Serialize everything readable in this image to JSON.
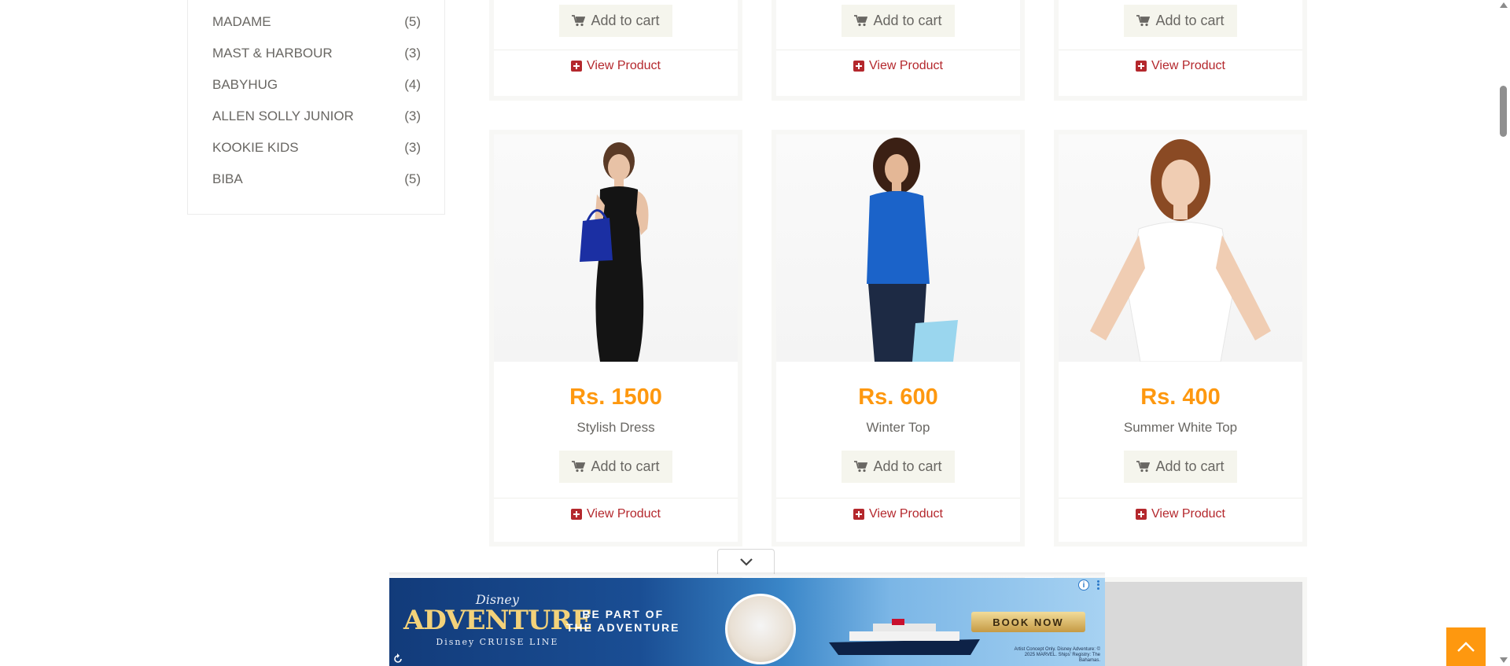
{
  "sidebar": {
    "brands": [
      {
        "name": "MADAME",
        "count": "(5)"
      },
      {
        "name": "MAST & HARBOUR",
        "count": "(3)"
      },
      {
        "name": "BABYHUG",
        "count": "(4)"
      },
      {
        "name": "ALLEN SOLLY JUNIOR",
        "count": "(3)"
      },
      {
        "name": "KOOKIE KIDS",
        "count": "(3)"
      },
      {
        "name": "BIBA",
        "count": "(5)"
      }
    ]
  },
  "top_row": [
    {
      "add_to_cart": "Add to cart",
      "view_product": "View Product"
    },
    {
      "add_to_cart": "Add to cart",
      "view_product": "View Product"
    },
    {
      "add_to_cart": "Add to cart",
      "view_product": "View Product"
    }
  ],
  "products": [
    {
      "price": "Rs. 1500",
      "name": "Stylish Dress",
      "add_to_cart": "Add to cart",
      "view_product": "View Product"
    },
    {
      "price": "Rs. 600",
      "name": "Winter Top",
      "add_to_cart": "Add to cart",
      "view_product": "View Product"
    },
    {
      "price": "Rs. 400",
      "name": "Summer White Top",
      "add_to_cart": "Add to cart",
      "view_product": "View Product"
    }
  ],
  "ad": {
    "brand_top": "Disney",
    "brand_main": "ADVENTURE",
    "brand_sub": "Disney CRUISE LINE",
    "tagline_1": "BE PART OF",
    "tagline_2": "THE ADVENTURE",
    "cta": "BOOK NOW",
    "fine_print": "Artist Concept Only. Disney Adventure: © 2025 MARVEL. Ships' Registry: The Bahamas.",
    "info_icon": "info-icon",
    "menu_icon": "kebab-menu-icon"
  },
  "colors": {
    "price": "#fe980f",
    "view_link": "#b4282d",
    "text": "#696763",
    "button_bg": "#f5f5ed",
    "scroll_top_bg": "#fe980f"
  }
}
